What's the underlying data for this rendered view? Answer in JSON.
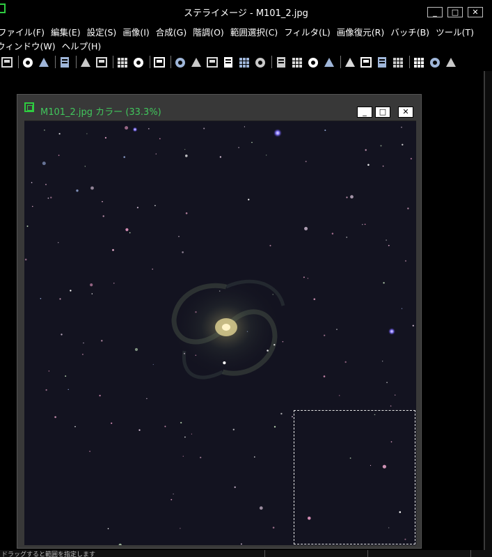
{
  "app": {
    "title": "ステライメージ - M101_2.jpg",
    "window_buttons": {
      "minimize": "_",
      "maximize": "□",
      "close": "✕"
    }
  },
  "menu": {
    "row1": [
      "ファイル(F)",
      "編集(E)",
      "設定(S)",
      "画像(I)",
      "合成(G)",
      "階調(O)",
      "範囲選択(C)",
      "フィルタ(L)",
      "画像復元(R)",
      "バッチ(B)",
      "ツール(T)"
    ],
    "row2": [
      "ウィンドウ(W)",
      "ヘルプ(H)"
    ]
  },
  "toolbar": {
    "groups": [
      [
        "open-icon"
      ],
      [
        "save-icon",
        "align-icon"
      ],
      [
        "export-icon"
      ],
      [
        "copy-icon",
        "paste-icon"
      ],
      [
        "new-window-icon",
        "display-icon"
      ],
      [
        "info-icon"
      ],
      [
        "levels-icon",
        "filter-icon",
        "sharpen-icon",
        "stack-icon",
        "composite-icon",
        "frame-icon"
      ],
      [
        "rgb-split-icon",
        "grid-icon",
        "batch-icon",
        "star-icon"
      ],
      [
        "measure-icon",
        "histogram-icon",
        "layers-icon",
        "globe-icon"
      ],
      [
        "zoom-in-icon",
        "zoom-tool-icon",
        "curve-icon"
      ]
    ]
  },
  "document": {
    "title": "M101_2.jpg カラー (33.3%)",
    "buttons": {
      "minimize": "_",
      "maximize": "□",
      "close": "✕"
    }
  },
  "statusbar": {
    "text": "ドラッグすると範囲を指定します"
  },
  "colors": {
    "title_green": "#41c65c",
    "sky_background": "#131320",
    "window_gray": "#383838"
  }
}
